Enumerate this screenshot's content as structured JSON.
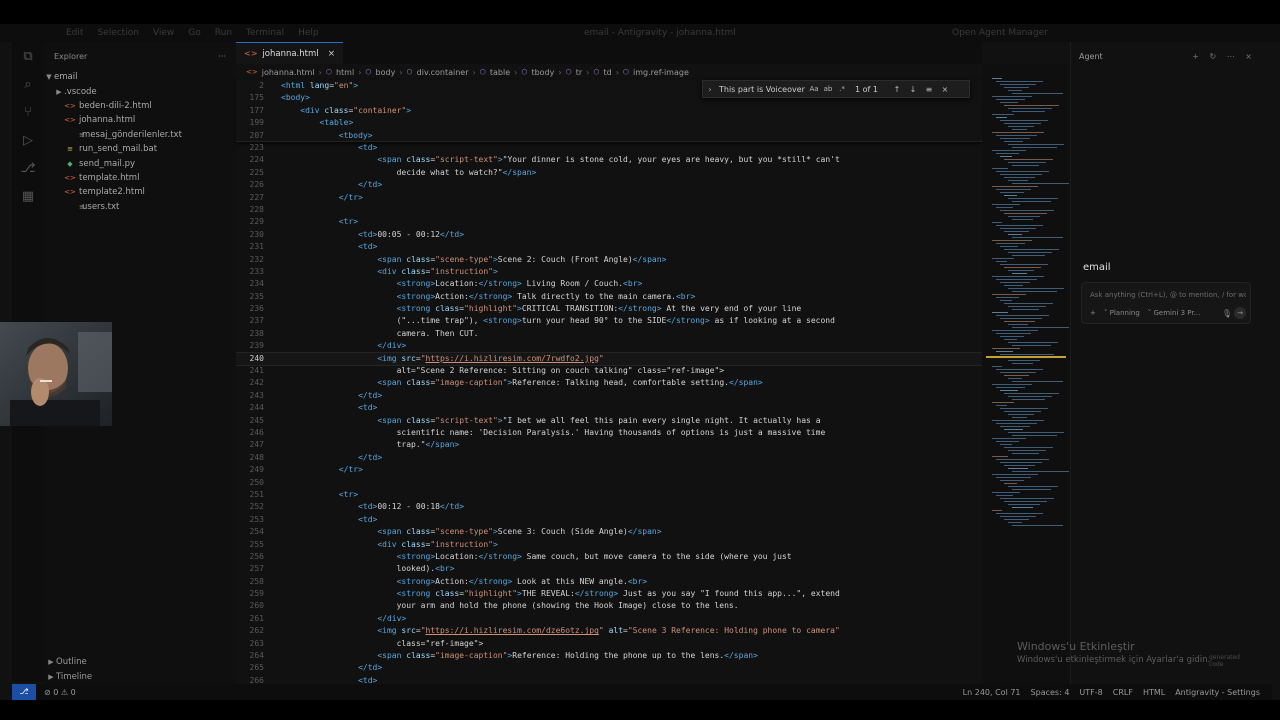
{
  "titlebar": {
    "menus": [
      "Edit",
      "Selection",
      "View",
      "Go",
      "Run",
      "Terminal",
      "Help"
    ],
    "title": "email - Antigravity - johanna.html",
    "agent_manager": "Open Agent Manager"
  },
  "activity_icons": [
    "explorer-icon",
    "search-icon",
    "source-control-icon",
    "run-debug-icon",
    "remote-icon",
    "extensions-icon"
  ],
  "explorer": {
    "title": "Explorer",
    "more": "···",
    "root": "email",
    "items": [
      {
        "label": ".vscode",
        "kind": "fld"
      },
      {
        "label": "beden-dili-2.html",
        "kind": "html"
      },
      {
        "label": "johanna.html",
        "kind": "html"
      },
      {
        "label": "mesaj_gönderilenler.txt",
        "kind": "txt"
      },
      {
        "label": "run_send_mail.bat",
        "kind": "bat"
      },
      {
        "label": "send_mail.py",
        "kind": "py"
      },
      {
        "label": "template.html",
        "kind": "html"
      },
      {
        "label": "template2.html",
        "kind": "html"
      },
      {
        "label": "users.txt",
        "kind": "txt"
      }
    ],
    "outline": "Outline",
    "timeline": "Timeline"
  },
  "tab": {
    "label": "johanna.html",
    "close": "×"
  },
  "breadcrumb": [
    "johanna.html",
    "html",
    "body",
    "div.container",
    "table",
    "tbody",
    "tr",
    "td",
    "img.ref-image"
  ],
  "find": {
    "value": "This part is Voiceover",
    "options": [
      "Aa",
      "ab",
      ".*"
    ],
    "count": "1 of 1"
  },
  "sticky_lines": [
    {
      "n": "2",
      "code": "<html lang=\"en\">"
    },
    {
      "n": "175",
      "code": "<body>"
    },
    {
      "n": "177",
      "code": "    <div class=\"container\">"
    },
    {
      "n": "199",
      "code": "        <table>"
    },
    {
      "n": "207",
      "code": "            <tbody>"
    }
  ],
  "code_lines": [
    {
      "n": "223",
      "code": "                <td>"
    },
    {
      "n": "224",
      "code": "                    <span class=\"script-text\">\"Your dinner is stone cold, your eyes are heavy, but you *still* can't"
    },
    {
      "n": "225",
      "code": "                        decide what to watch?\"</span>"
    },
    {
      "n": "226",
      "code": "                </td>"
    },
    {
      "n": "227",
      "code": "            </tr>"
    },
    {
      "n": "228",
      "code": ""
    },
    {
      "n": "229",
      "code": "            <tr>"
    },
    {
      "n": "230",
      "code": "                <td>00:05 - 00:12</td>"
    },
    {
      "n": "231",
      "code": "                <td>"
    },
    {
      "n": "232",
      "code": "                    <span class=\"scene-type\">Scene 2: Couch (Front Angle)</span>"
    },
    {
      "n": "233",
      "code": "                    <div class=\"instruction\">"
    },
    {
      "n": "234",
      "code": "                        <strong>Location:</strong> Living Room / Couch.<br>"
    },
    {
      "n": "235",
      "code": "                        <strong>Action:</strong> Talk directly to the main camera.<br>"
    },
    {
      "n": "236",
      "code": "                        <strong class=\"highlight\">CRITICAL TRANSITION:</strong> At the very end of your line"
    },
    {
      "n": "237",
      "code": "                        (\"...time trap\"), <strong>turn your head 90° to the SIDE</strong> as if looking at a second"
    },
    {
      "n": "238",
      "code": "                        camera. Then CUT."
    },
    {
      "n": "239",
      "code": "                    </div>"
    },
    {
      "n": "240",
      "code": "                    <img src=\"https://i.hizliresim.com/7rwdfo2.jpg\""
    },
    {
      "n": "241",
      "code": "                        alt=\"Scene 2 Reference: Sitting on couch talking\" class=\"ref-image\">"
    },
    {
      "n": "242",
      "code": "                    <span class=\"image-caption\">Reference: Talking head, comfortable setting.</span>"
    },
    {
      "n": "243",
      "code": "                </td>"
    },
    {
      "n": "244",
      "code": "                <td>"
    },
    {
      "n": "245",
      "code": "                    <span class=\"script-text\">\"I bet we all feel this pain every single night. It actually has a"
    },
    {
      "n": "246",
      "code": "                        scientific name: 'Decision Paralysis.' Having thousands of options is just a massive time"
    },
    {
      "n": "247",
      "code": "                        trap.\"</span>"
    },
    {
      "n": "248",
      "code": "                </td>"
    },
    {
      "n": "249",
      "code": "            </tr>"
    },
    {
      "n": "250",
      "code": ""
    },
    {
      "n": "251",
      "code": "            <tr>"
    },
    {
      "n": "252",
      "code": "                <td>00:12 - 00:18</td>"
    },
    {
      "n": "253",
      "code": "                <td>"
    },
    {
      "n": "254",
      "code": "                    <span class=\"scene-type\">Scene 3: Couch (Side Angle)</span>"
    },
    {
      "n": "255",
      "code": "                    <div class=\"instruction\">"
    },
    {
      "n": "256",
      "code": "                        <strong>Location:</strong> Same couch, but move camera to the side (where you just"
    },
    {
      "n": "257",
      "code": "                        looked).<br>"
    },
    {
      "n": "258",
      "code": "                        <strong>Action:</strong> Look at this NEW angle.<br>"
    },
    {
      "n": "259",
      "code": "                        <strong class=\"highlight\">THE REVEAL:</strong> Just as you say \"I found this app...\", extend"
    },
    {
      "n": "260",
      "code": "                        your arm and hold the phone (showing the Hook Image) close to the lens."
    },
    {
      "n": "261",
      "code": "                    </div>"
    },
    {
      "n": "262",
      "code": "                    <img src=\"https://i.hizliresim.com/dze6otz.jpg\" alt=\"Scene 3 Reference: Holding phone to camera\""
    },
    {
      "n": "263",
      "code": "                        class=\"ref-image\">"
    },
    {
      "n": "264",
      "code": "                    <span class=\"image-caption\">Reference: Holding the phone up to the lens.</span>"
    },
    {
      "n": "265",
      "code": "                </td>"
    },
    {
      "n": "266",
      "code": "                <td>"
    }
  ],
  "active_line": "240",
  "agent": {
    "title": "Agent",
    "workspace": "email",
    "placeholder": "Ask anything (Ctrl+L), @ to mention, / for workflows",
    "add": "+",
    "mode": "Planning",
    "model": "Gemini 3 Pr...",
    "mic": "🎙",
    "send": "→"
  },
  "status": {
    "remote": "⎇",
    "problems": "⊘ 0 ⚠ 0",
    "right": [
      "Ln 240, Col 71",
      "Spaces: 4",
      "UTF-8",
      "CRLF",
      "HTML",
      "Antigravity - Settings"
    ]
  },
  "watermark": {
    "title": "Windows'u Etkinleştir",
    "subtitle": "Windows'u etkinleştirmek için Ayarlar'a gidin.",
    "note": "generated code"
  },
  "colors": {
    "tag": "#56a8e0",
    "attr": "#9cdcfe",
    "string": "#ce9178",
    "text": "#d4d4d4",
    "status_remote": "#1c4ea6"
  }
}
